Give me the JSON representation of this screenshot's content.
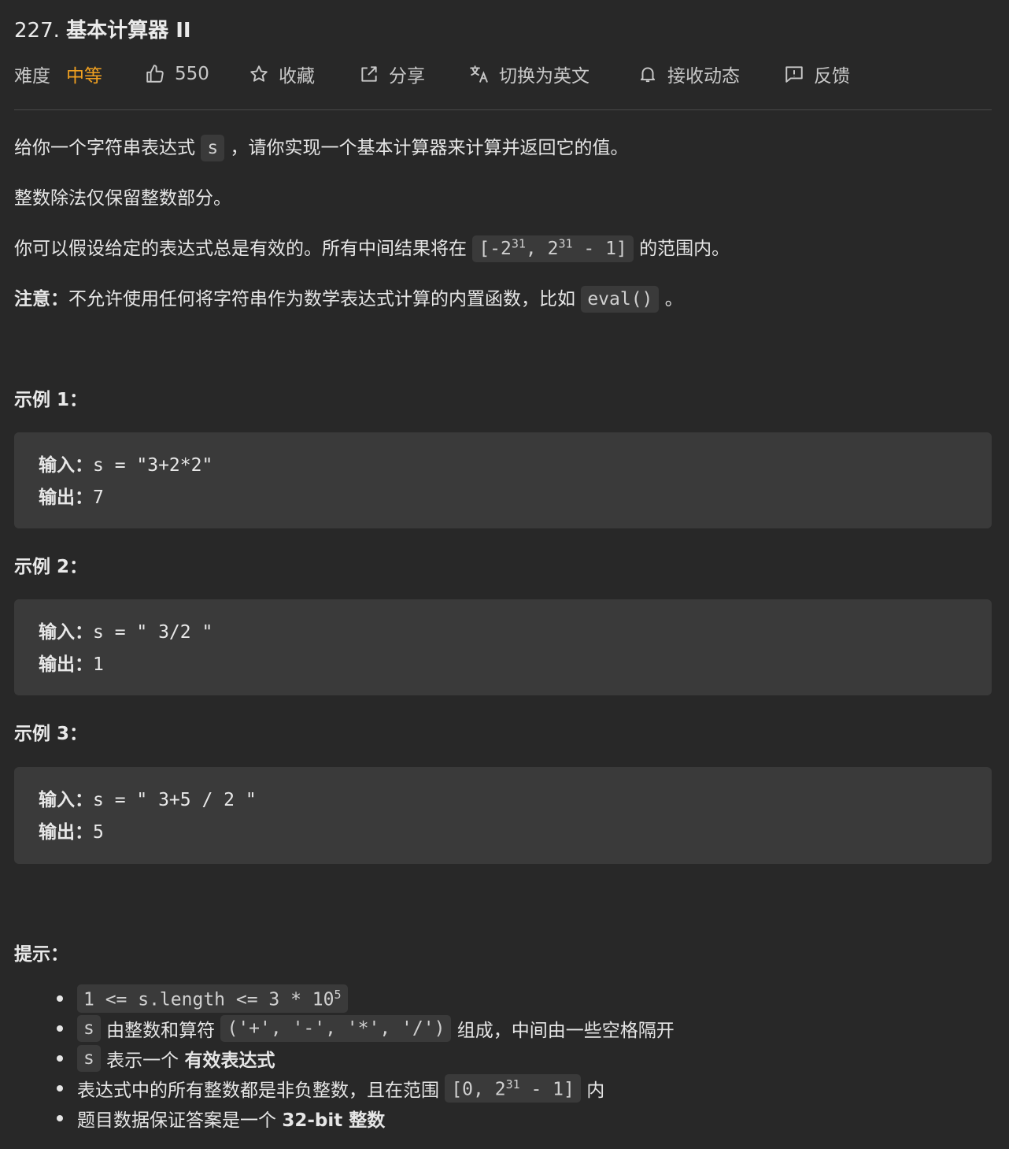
{
  "problem": {
    "number": "227.",
    "name": "基本计算器 II"
  },
  "toolbar": {
    "difficulty_label": "难度",
    "difficulty_value": "中等",
    "like_count": "550",
    "collect": "收藏",
    "share": "分享",
    "switch_lang": "切换为英文",
    "subscribe": "接收动态",
    "feedback": "反馈",
    "accent_color": "#f0a020"
  },
  "description": {
    "p1_a": "给你一个字符串表达式",
    "p1_code": "s",
    "p1_b": "，请你实现一个基本计算器来计算并返回它的值。",
    "p2": "整数除法仅保留整数部分。",
    "p3_a": "你可以假设给定的表达式总是有效的。所有中间结果将在",
    "p3_code_a": "[-2",
    "p3_sup1": "31",
    "p3_code_b": ", 2",
    "p3_sup2": "31",
    "p3_code_c": " - 1]",
    "p3_b": "的范围内。",
    "note_label": "注意：",
    "note_text": "不允许使用任何将字符串作为数学表达式计算的内置函数，比如",
    "note_code": "eval()",
    "note_end": "。"
  },
  "examples": [
    {
      "title": "示例 1：",
      "input_label": "输入：",
      "input": "s = \"3+2*2\"",
      "output_label": "输出：",
      "output": "7"
    },
    {
      "title": "示例 2：",
      "input_label": "输入：",
      "input": "s = \" 3/2 \"",
      "output_label": "输出：",
      "output": "1"
    },
    {
      "title": "示例 3：",
      "input_label": "输入：",
      "input": "s = \" 3+5 / 2 \"",
      "output_label": "输出：",
      "output": "5"
    }
  ],
  "hints": {
    "title": "提示：",
    "h1_code": "1 <= s.length <= 3 * 10",
    "h1_sup": "5",
    "h2_code": "s",
    "h2_text": "由整数和算符",
    "h2_ops": "('+', '-', '*', '/')",
    "h2_end": "组成，中间由一些空格隔开",
    "h3_code": "s",
    "h3_text": "表示一个",
    "h3_bold": "有效表达式",
    "h4_text": "表达式中的所有整数都是非负整数，且在范围",
    "h4_code_a": "[0, 2",
    "h4_sup": "31",
    "h4_code_b": " - 1]",
    "h4_end": "内",
    "h5_text": "题目数据保证答案是一个",
    "h5_bold": "32-bit 整数"
  }
}
